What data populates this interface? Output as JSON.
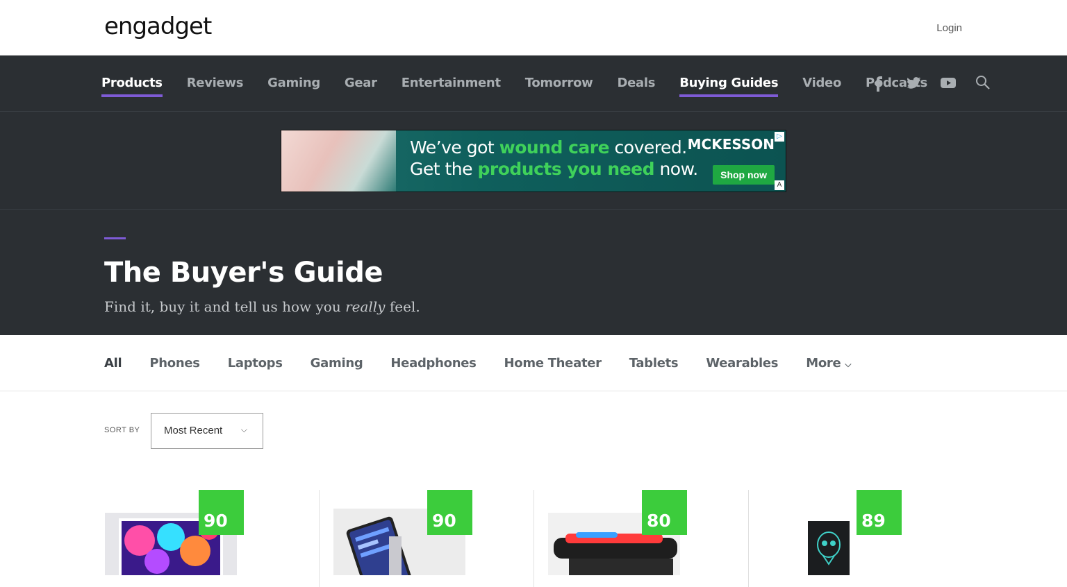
{
  "header": {
    "logo_text": "engadget",
    "login_label": "Login"
  },
  "nav": {
    "items": [
      {
        "label": "Products",
        "active": true
      },
      {
        "label": "Reviews",
        "active": false
      },
      {
        "label": "Gaming",
        "active": false
      },
      {
        "label": "Gear",
        "active": false
      },
      {
        "label": "Entertainment",
        "active": false
      },
      {
        "label": "Tomorrow",
        "active": false
      },
      {
        "label": "Deals",
        "active": false
      },
      {
        "label": "Buying Guides",
        "active": true
      },
      {
        "label": "Video",
        "active": false
      },
      {
        "label": "Podcasts",
        "active": false
      }
    ],
    "social_icons": [
      "facebook-icon",
      "twitter-icon",
      "youtube-icon",
      "search-icon"
    ]
  },
  "ad": {
    "line1_pre": "We’ve got ",
    "line1_hl": "wound care",
    "line1_post": " covered.",
    "line2_pre": "Get the ",
    "line2_hl": "products you need",
    "line2_post": " now.",
    "brand": "MCKESSON",
    "cta": "Shop now",
    "adchoices_glyph": "▷",
    "corner_glyph": "A"
  },
  "hero": {
    "title": "The Buyer's Guide",
    "subtitle_pre": "Find it, buy it and tell us how you ",
    "subtitle_em": "really",
    "subtitle_post": " feel."
  },
  "categories": {
    "items": [
      "All",
      "Phones",
      "Laptops",
      "Gaming",
      "Headphones",
      "Home Theater",
      "Tablets",
      "Wearables"
    ],
    "more_label": "More",
    "more_chevron": "⌵"
  },
  "sort": {
    "label": "SORT BY",
    "value": "Most Recent",
    "chevron": "⌵"
  },
  "products": [
    {
      "score": "90"
    },
    {
      "score": "90"
    },
    {
      "score": "80"
    },
    {
      "score": "89"
    }
  ],
  "colors": {
    "accent": "#7e5bd6",
    "nav_bg": "#2b2f33",
    "score_green": "#3ccc3c"
  }
}
